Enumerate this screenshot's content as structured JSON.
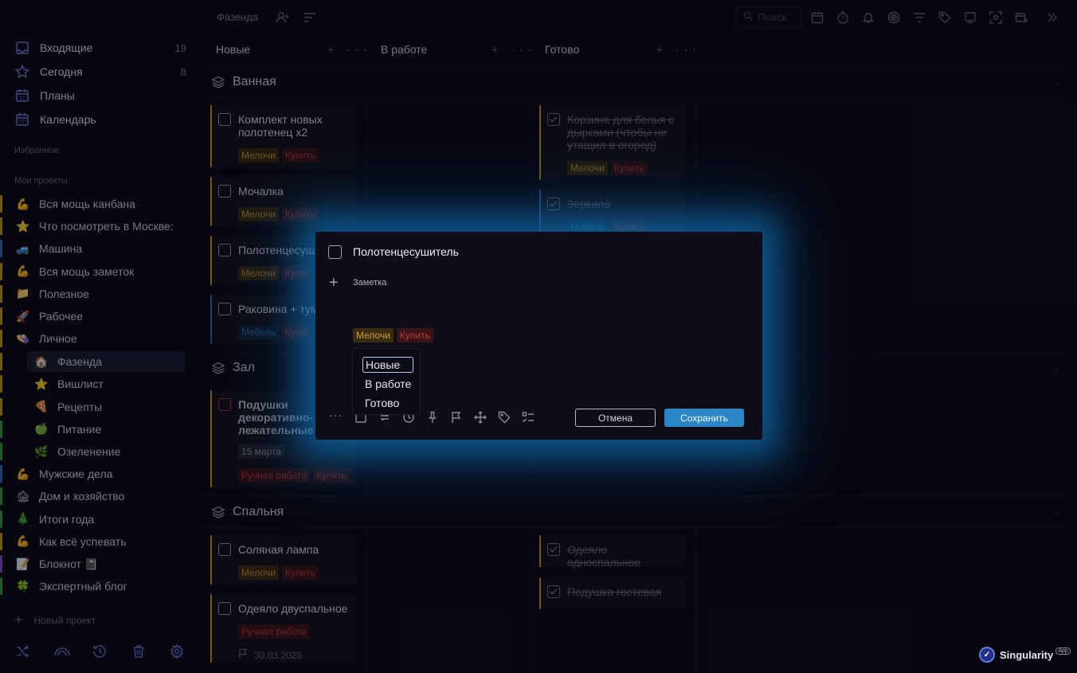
{
  "sidebar": {
    "nav": [
      {
        "label": "Входящие",
        "count": "19",
        "icon": "inbox-icon"
      },
      {
        "label": "Сегодня",
        "count": "8",
        "icon": "star-icon"
      },
      {
        "label": "Планы",
        "count": "",
        "icon": "calendar-12-icon"
      },
      {
        "label": "Календарь",
        "count": "",
        "icon": "calendar-grid-icon"
      }
    ],
    "favorites_title": "Избранное",
    "projects_title": "Мои проекты",
    "projects": [
      {
        "emoji": "💪",
        "label": "Вся мощь канбана",
        "bar": "#c9a21e"
      },
      {
        "emoji": "⭐",
        "label": "Что посмотреть в Москве: г",
        "bar": "#c9a21e"
      },
      {
        "emoji": "🚙",
        "label": "Машина",
        "bar": "#3b6fb8"
      },
      {
        "emoji": "💪",
        "label": "Вся мощь заметок",
        "bar": "#c9a21e"
      },
      {
        "emoji": "📁",
        "label": "Полезное",
        "bar": "#c9a21e"
      },
      {
        "emoji": "🚀",
        "label": "Рабочее",
        "bar": "#c9a21e"
      },
      {
        "emoji": "👒",
        "label": "Личное",
        "bar": "#c9a21e"
      },
      {
        "emoji": "🏠",
        "label": "Фазенда",
        "bar": "#c9a21e",
        "sub": true,
        "active": true
      },
      {
        "emoji": "⭐",
        "label": "Вишлист",
        "bar": "#c9a21e",
        "sub": true
      },
      {
        "emoji": "🍕",
        "label": "Рецепты",
        "bar": "#c9a21e",
        "sub": true
      },
      {
        "emoji": "🍏",
        "label": "Питание",
        "bar": "#3e9c4b",
        "sub": true
      },
      {
        "emoji": "🌿",
        "label": "Озеленение",
        "bar": "#3e9c4b",
        "sub": true
      },
      {
        "emoji": "💪",
        "label": "Мужские дела",
        "bar": "#3b6fb8"
      },
      {
        "emoji": "🏚",
        "label": "Дом и хозяйство",
        "bar": "#3e9c4b"
      },
      {
        "emoji": "🎄",
        "label": "Итоги года",
        "bar": "#3e9c4b"
      },
      {
        "emoji": "💪",
        "label": "Как всё успевать",
        "bar": "#c9a21e"
      },
      {
        "emoji": "📝",
        "label": "Блокнот 📓",
        "bar": "#8a4fc4"
      },
      {
        "emoji": "🍀",
        "label": "Экспертный блог",
        "bar": "#3e9c4b"
      }
    ],
    "new_project": "Новый проект",
    "bottom_icons": [
      "shuffle-icon",
      "rainbow-icon",
      "history-icon",
      "trash-icon",
      "settings-icon"
    ]
  },
  "topbar": {
    "title": "Фазенда",
    "search_placeholder": "Поиск"
  },
  "columns": [
    "Новые",
    "В работе",
    "Готово"
  ],
  "swimlanes": {
    "bath": "Ванная",
    "hall": "Зал",
    "bedroom": "Спальня"
  },
  "cards": {
    "c1": {
      "title": "Комплект новых полотенец x2",
      "tags": [
        "Мелочи",
        "Купить"
      ]
    },
    "c2": {
      "title": "Мочалка",
      "tags": [
        "Мелочи",
        "Купить"
      ]
    },
    "c3": {
      "title": "Полотенцесуш",
      "tags": [
        "Мелочи",
        "Купи"
      ]
    },
    "c4": {
      "title": "Раковина + тум",
      "tags": [
        "Мебель",
        "Купи"
      ]
    },
    "c5": {
      "title": "Корзина для белья с дырками (чтобы не утащил в огород)",
      "tags": [
        "Мелочи",
        "Купить"
      ]
    },
    "c6": {
      "title": "Зеркало",
      "tags": [
        "Мебель",
        "Купить"
      ]
    },
    "c7": {
      "title": "Подушки декоративно-лежательные х",
      "date": "15 марта",
      "tags": [
        "Ручная работа",
        "Купить"
      ]
    },
    "c8": {
      "title": "Соляная лампа",
      "tags": [
        "Мелочи",
        "Купить"
      ]
    },
    "c9": {
      "title": "Одеяло двуспальное",
      "tags": [
        "Ручная работа"
      ],
      "date": "30.03.2025"
    },
    "c10": {
      "title": "Одеяло односпальное"
    },
    "c11": {
      "title": "Подушка гостевая"
    }
  },
  "modal": {
    "title": "Полотенцесушитель",
    "note_placeholder": "Заметка",
    "tags": [
      "Мелочи",
      "Купить"
    ],
    "status_options": [
      "Новые",
      "В работе",
      "Готово"
    ],
    "selected_status": "Новые",
    "cancel": "Отмена",
    "save": "Сохранить"
  },
  "brand": {
    "name": "Singularity",
    "badge": "App"
  },
  "colors": {
    "accent": "#2a86c7",
    "glow": "#1382cc",
    "tag_yellow": "#c89a30",
    "tag_red": "#c1373c",
    "tag_blue": "#3a6fa8"
  }
}
